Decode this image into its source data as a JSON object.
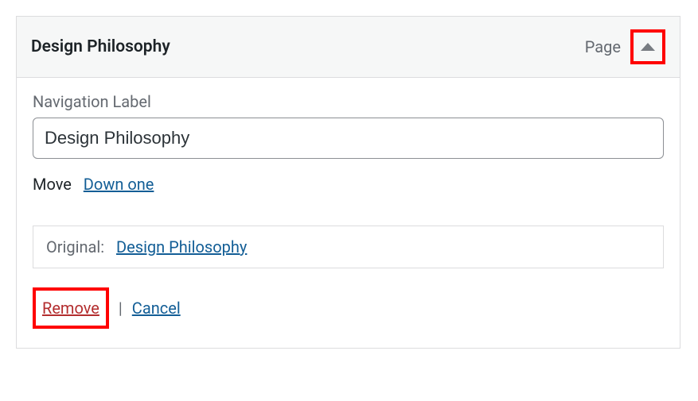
{
  "menuItem": {
    "title": "Design Philosophy",
    "type": "Page",
    "navigationLabel": {
      "label": "Navigation Label",
      "value": "Design Philosophy"
    },
    "move": {
      "label": "Move",
      "downOne": "Down one"
    },
    "original": {
      "label": "Original:",
      "linkText": "Design Philosophy"
    },
    "actions": {
      "remove": "Remove",
      "separator": "|",
      "cancel": "Cancel"
    }
  }
}
